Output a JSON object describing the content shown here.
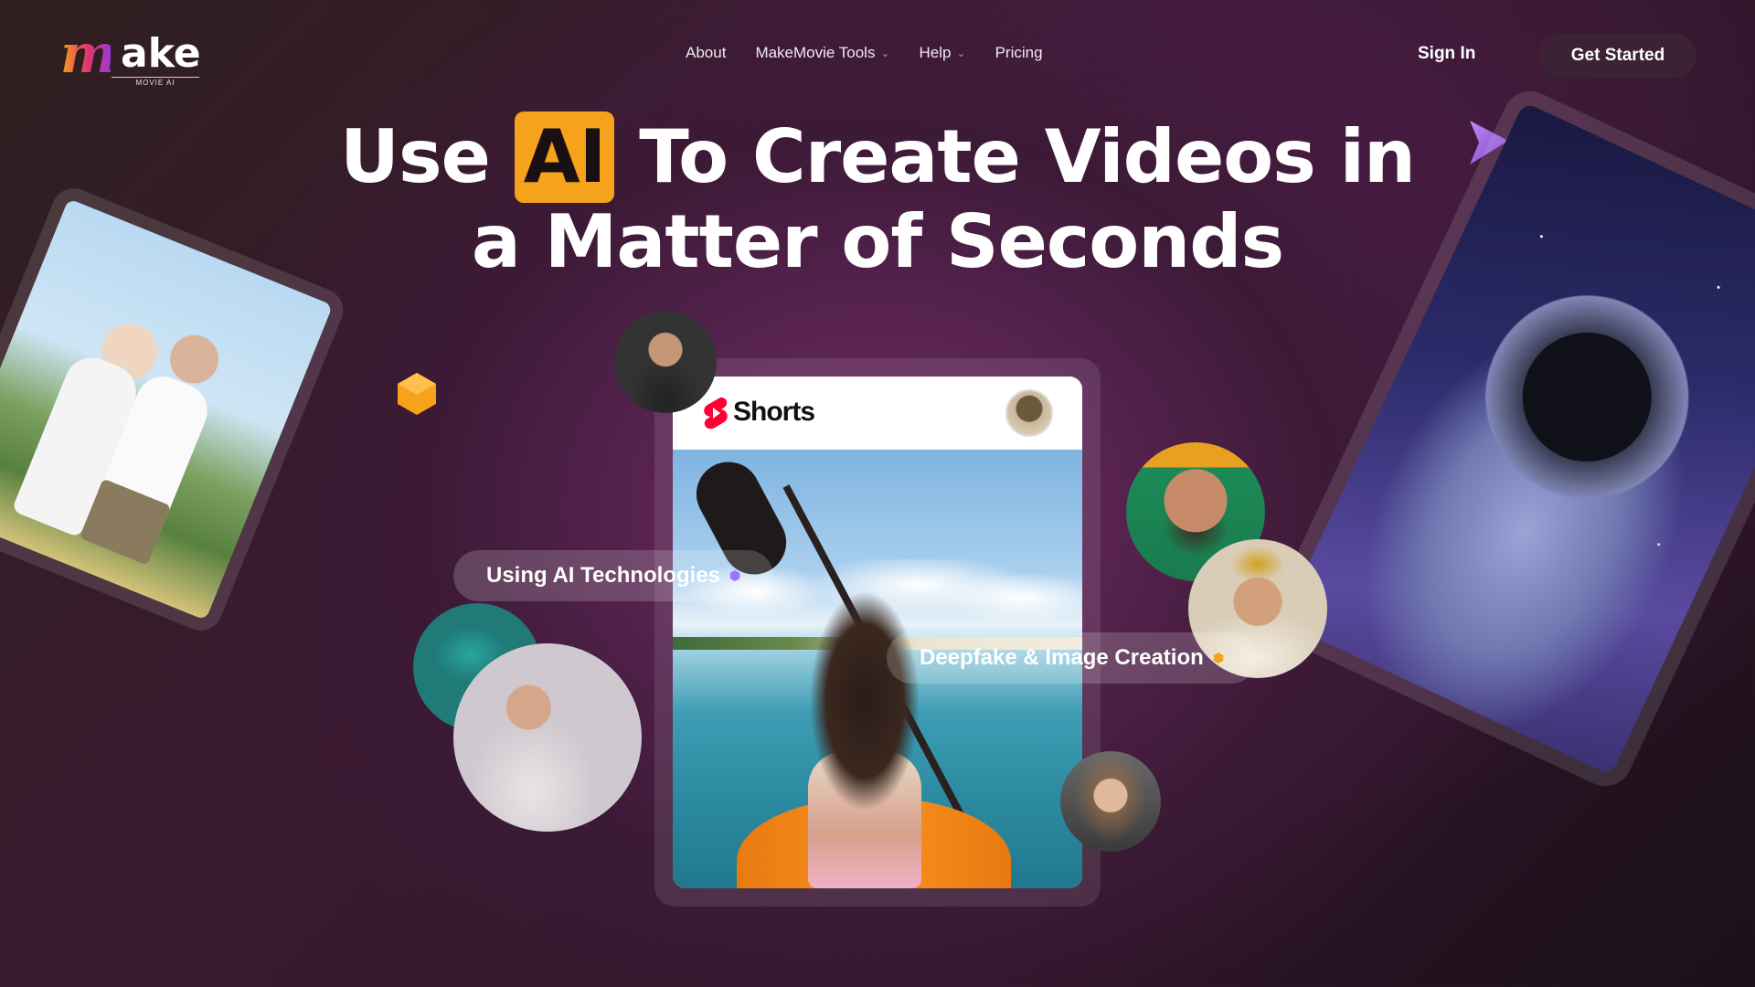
{
  "brand": {
    "logo_letter": "m",
    "logo_rest": "ake",
    "logo_sub": "MOVIE AI"
  },
  "nav": {
    "items": [
      {
        "label": "About",
        "has_dropdown": false
      },
      {
        "label": "MakeMovie Tools",
        "has_dropdown": true
      },
      {
        "label": "Help",
        "has_dropdown": true
      },
      {
        "label": "Pricing",
        "has_dropdown": false
      }
    ],
    "sign_in": "Sign In",
    "get_started": "Get Started"
  },
  "hero": {
    "headline_pre": "Use",
    "headline_highlight": "AI",
    "headline_post_line1": "To Create Videos in",
    "headline_line2": "a Matter of Seconds"
  },
  "card": {
    "platform_label": "Shorts"
  },
  "pills": {
    "left": "Using AI Technologies",
    "right": "Deepfake & Image Creation"
  },
  "colors": {
    "accent_orange": "#f7a21b",
    "button_bg": "#3b2234",
    "pill_bg": "rgba(255,255,255,0.18)",
    "shorts_red": "#ff0033"
  },
  "icons": {
    "chevron": "chevron-down-icon",
    "shorts": "youtube-shorts-icon",
    "cursor": "cursor-arrow-icon",
    "hexagon": "hexagon-icon"
  }
}
